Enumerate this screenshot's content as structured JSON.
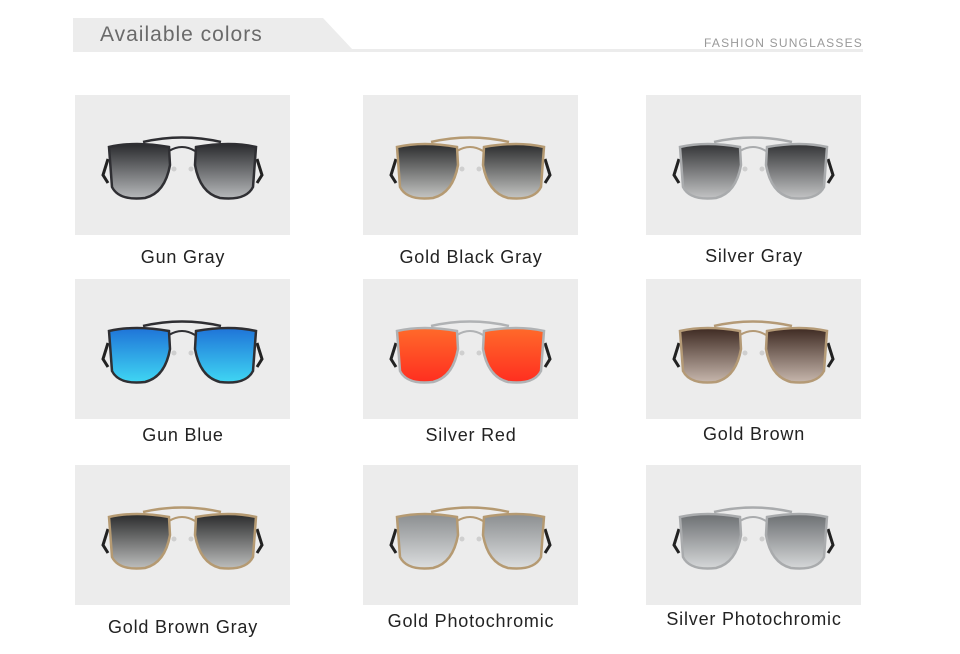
{
  "header": {
    "title": "Available colors",
    "subtitle": "FASHION SUNGLASSES"
  },
  "colors": [
    {
      "name": "Gun Gray",
      "frame": "#2f2f33",
      "lens_top": "#2a2b2e",
      "lens_bottom": "#b7b9bb"
    },
    {
      "name": "Gold Black Gray",
      "frame": "#b59a72",
      "lens_top": "#2b2c2d",
      "lens_bottom": "#c5c6c4"
    },
    {
      "name": "Silver Gray",
      "frame": "#a9abad",
      "lens_top": "#333436",
      "lens_bottom": "#c3c4c5"
    },
    {
      "name": "Gun Blue",
      "frame": "#2f2f33",
      "lens_top": "#1f74d8",
      "lens_bottom": "#3fd6f3"
    },
    {
      "name": "Silver Red",
      "frame": "#b0b2b4",
      "lens_top": "#ff6a2a",
      "lens_bottom": "#ff2e20"
    },
    {
      "name": "Gold Brown",
      "frame": "#b49a76",
      "lens_top": "#3e2a22",
      "lens_bottom": "#c7b7ad"
    },
    {
      "name": "Gold Brown Gray",
      "frame": "#b59a72",
      "lens_top": "#2a2b2c",
      "lens_bottom": "#bdbebd"
    },
    {
      "name": "Gold Photochromic",
      "frame": "#b59a72",
      "lens_top": "#8b8e90",
      "lens_bottom": "#dcdedf"
    },
    {
      "name": "Silver Photochromic",
      "frame": "#a9abad",
      "lens_top": "#6c6f72",
      "lens_bottom": "#d6d8d9"
    }
  ]
}
